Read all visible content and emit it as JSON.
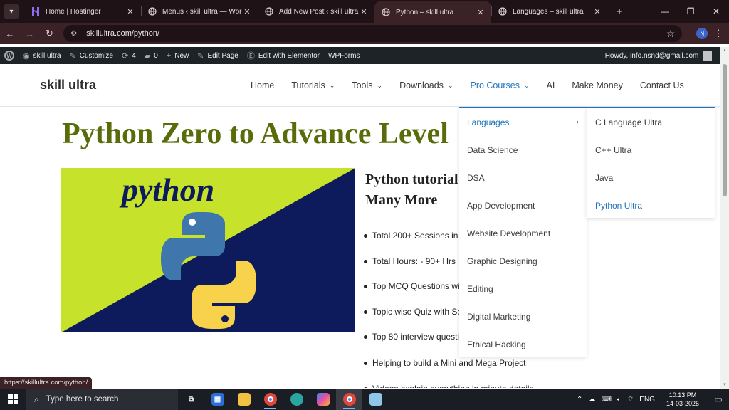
{
  "browser": {
    "tabs": [
      {
        "title": "Home | Hostinger",
        "icon": "hostinger-icon",
        "active": false
      },
      {
        "title": "Menus ‹ skill ultra — WordPress",
        "icon": "globe-icon",
        "active": false
      },
      {
        "title": "Add New Post ‹ skill ultra — WordPress",
        "icon": "globe-icon",
        "active": false
      },
      {
        "title": "Python – skill ultra",
        "icon": "globe-icon",
        "active": true
      },
      {
        "title": "Languages – skill ultra",
        "icon": "globe-icon",
        "active": false
      }
    ],
    "url": "skillultra.com/python/",
    "profile_initial": "N",
    "status_url": "https://skillultra.com/python/",
    "colors": {
      "frame": "#1f1216",
      "toolbar": "#3b2226"
    }
  },
  "adminbar": {
    "site_name": "skill ultra",
    "customize": "Customize",
    "updates_count": "4",
    "comments_count": "0",
    "new": "New",
    "edit_page": "Edit Page",
    "edit_elementor": "Edit with Elementor",
    "wpforms": "WPForms",
    "howdy": "Howdy, info.nsnd@gmail.com"
  },
  "site": {
    "title": "skill ultra",
    "nav": [
      {
        "label": "Home",
        "dropdown": false
      },
      {
        "label": "Tutorials",
        "dropdown": true
      },
      {
        "label": "Tools",
        "dropdown": true
      },
      {
        "label": "Downloads",
        "dropdown": true
      },
      {
        "label": "Pro Courses",
        "dropdown": true,
        "current": true
      },
      {
        "label": "AI",
        "dropdown": false
      },
      {
        "label": "Make Money",
        "dropdown": false
      },
      {
        "label": "Contact Us",
        "dropdown": false
      }
    ],
    "pro_courses_menu": [
      "Languages",
      "Data Science",
      "DSA",
      "App Development",
      "Website Development",
      "Graphic Designing",
      "Editing",
      "Digital Marketing",
      "Ethical Hacking"
    ],
    "languages_submenu": [
      "C Language Ultra",
      "C++ Ultra",
      "Java",
      "Python Ultra"
    ],
    "accent_color": "#1e73be"
  },
  "page": {
    "title": "Python Zero to Advance Level",
    "hero_word": "python",
    "side_heading_line1": "Python tutorial",
    "side_heading_line2": "Many More",
    "features": [
      "Total 200+ Sessions in",
      " Total Hours: - 90+ Hrs",
      "Top MCQ Questions wi",
      "Topic wise Quiz with Sc",
      "Top 80 interview questi",
      "Helping to build a Mini and Mega Project",
      "Videos explain everything in minute details"
    ],
    "title_color": "#586d09"
  },
  "taskbar": {
    "search_placeholder": "Type here to search",
    "language": "ENG",
    "time": "10:13 PM",
    "date": "14-03-2025"
  }
}
